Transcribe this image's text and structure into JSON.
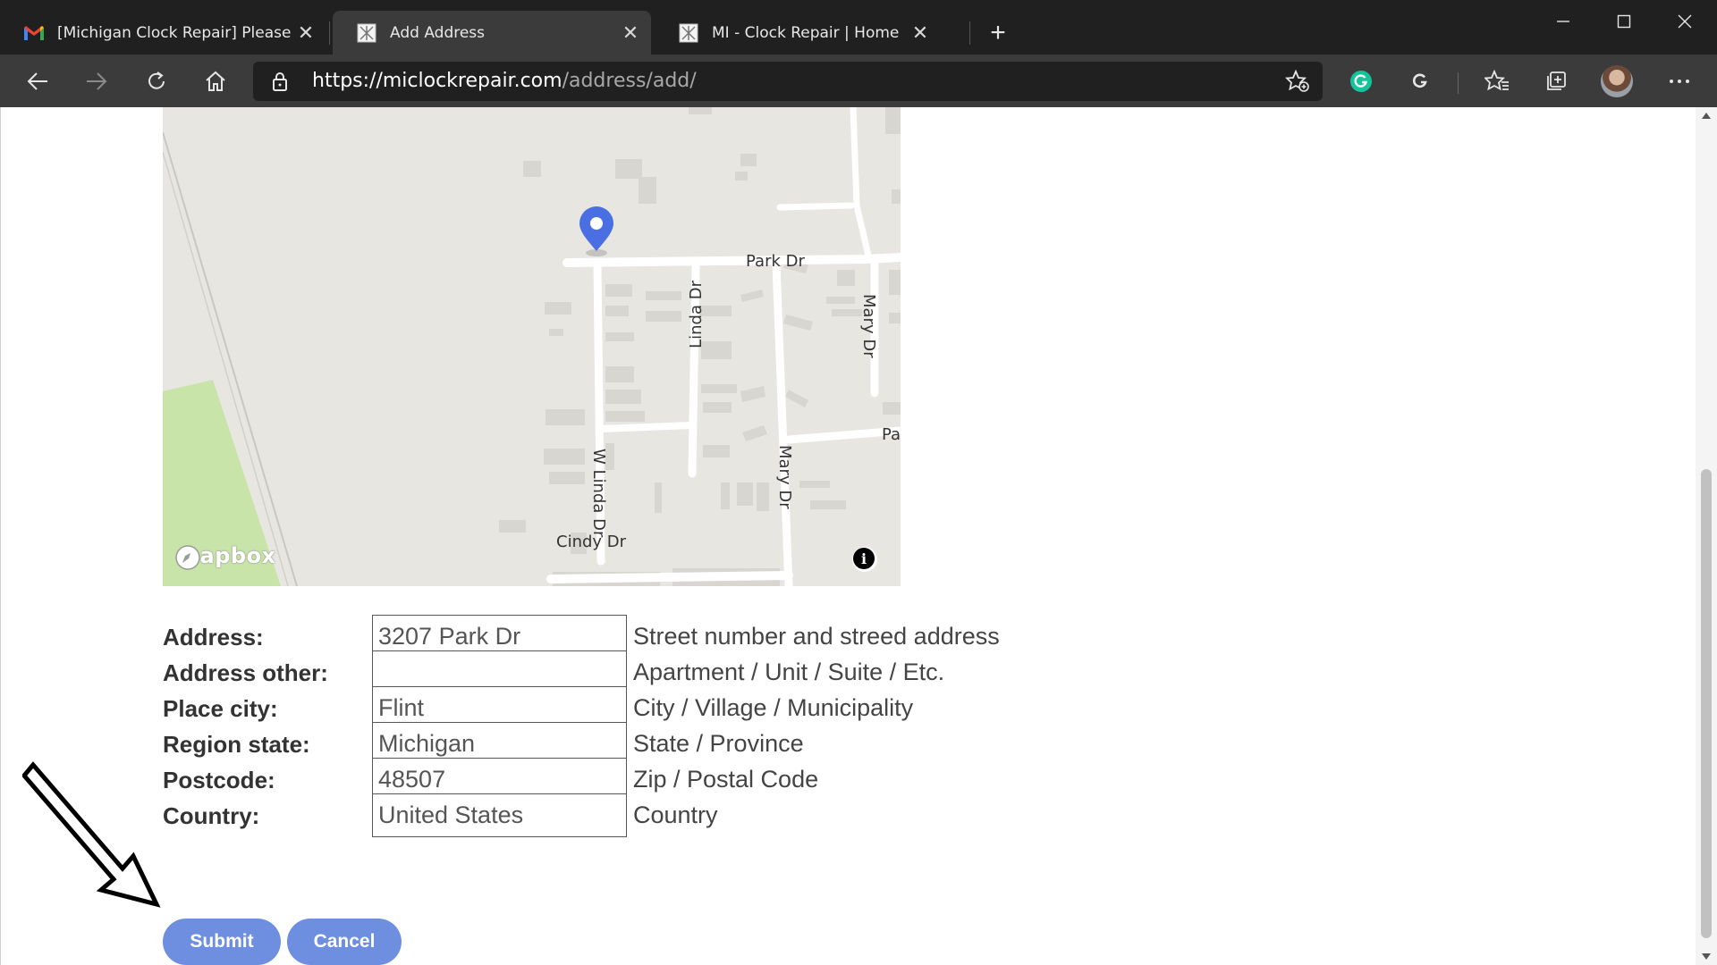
{
  "browser": {
    "tabs": [
      {
        "title": "[Michigan Clock Repair] Please C",
        "icon": "gmail-icon",
        "active": false
      },
      {
        "title": "Add Address",
        "icon": "site-favicon",
        "active": true
      },
      {
        "title": "MI - Clock Repair | Home",
        "icon": "site-favicon",
        "active": false
      }
    ],
    "new_tab_glyph": "+",
    "url": {
      "scheme_host": "https://miclockrepair.com",
      "path": "/address/add/"
    }
  },
  "map": {
    "streets": [
      "Park Dr",
      "Linda Dr",
      "Mary Dr",
      "Pa",
      "W Linda Dr",
      "Mary Dr",
      "Cindy Dr"
    ],
    "attribution": "mapbox",
    "info_glyph": "i",
    "colors": {
      "land": "#e8e6e1",
      "road": "#ffffff",
      "park": "#c8e4a8",
      "building": "#d6d4cf",
      "marker": "#4a6fe3"
    }
  },
  "form": {
    "fields": [
      {
        "label": "Address:",
        "value": "3207 Park Dr",
        "help": "Street number and streed address"
      },
      {
        "label": "Address other:",
        "value": "",
        "help": "Apartment / Unit / Suite / Etc."
      },
      {
        "label": "Place city:",
        "value": "Flint",
        "help": "City / Village / Municipality"
      },
      {
        "label": "Region state:",
        "value": "Michigan",
        "help": "State / Province"
      },
      {
        "label": "Postcode:",
        "value": "48507",
        "help": "Zip / Postal Code"
      },
      {
        "label": "Country:",
        "value": "United States",
        "help": "Country"
      }
    ],
    "submit_label": "Submit",
    "cancel_label": "Cancel",
    "button_color": "#6e8fe0"
  }
}
